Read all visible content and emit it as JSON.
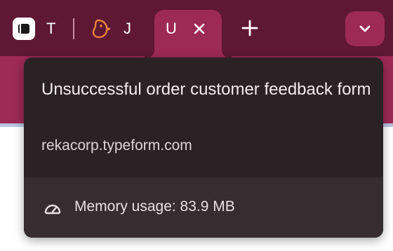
{
  "tabs": [
    {
      "title": "T",
      "icon": "intercom-logo-icon"
    },
    {
      "title": "J",
      "icon": "bird-logo-icon"
    },
    {
      "title": "U",
      "icon": "",
      "active": true
    }
  ],
  "new_tab_icon": "plus-icon",
  "tab_search_icon": "chevron-down-icon",
  "hover_card": {
    "title": "Unsuccessful order customer feedback form",
    "domain": "rekacorp.typeform.com",
    "memory_label": "Memory usage: 83.9 MB",
    "memory_icon": "speedometer-icon"
  },
  "colors": {
    "tabstrip_bg": "#5e1834",
    "toolbar_bg": "#9c2a55",
    "card_bg": "#2a2224",
    "card_footer_bg": "#352d30",
    "favicon_orange": "#e8833a"
  }
}
